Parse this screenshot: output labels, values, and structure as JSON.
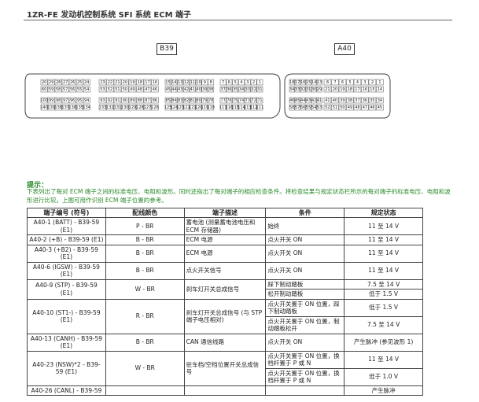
{
  "header": "1ZR-FE 发动机控制系统  SFI 系统  ECM 端子",
  "connectors": {
    "left_label": "B39",
    "right_label": "A40"
  },
  "diagram": {
    "b39_left_top": [
      "20",
      "29",
      "28",
      "27",
      "26",
      "25",
      "24"
    ],
    "b39_left_mid": [
      "60",
      "59",
      "58",
      "57",
      "56",
      "55",
      "54"
    ],
    "b39_left_low1": [
      "100",
      "99",
      "98",
      "97",
      "96",
      "95",
      "94"
    ],
    "b39_left_low2": [
      "140",
      "139",
      "138",
      "137",
      "136",
      "135",
      "134"
    ],
    "b39_mid_top": [
      "23",
      "22",
      "21",
      "20",
      "19",
      "18",
      "17",
      "16"
    ],
    "b39_mid_mid": [
      "53",
      "52",
      "51",
      "50",
      "49",
      "48",
      "47",
      "46"
    ],
    "b39_mid_low1": [
      "93",
      "92",
      "91",
      "90",
      "89",
      "88",
      "87",
      "86"
    ],
    "b39_mid_low2": [
      "133",
      "132",
      "131",
      "130",
      "129",
      "128",
      "127",
      "126"
    ],
    "b39_right_top": [
      "15",
      "14",
      "13",
      "12",
      "11",
      "10",
      "9",
      "8"
    ],
    "b39_right_mid": [
      "45",
      "44",
      "43",
      "42",
      "41",
      "40",
      "39",
      "38"
    ],
    "b39_right_low1": [
      "85",
      "84",
      "83",
      "82",
      "81",
      "80",
      "79",
      "78"
    ],
    "b39_right_low2": [
      "125",
      "124",
      "123",
      "122",
      "121",
      "120",
      "119",
      "118"
    ],
    "b39_end_top": [
      "7",
      "6",
      "5",
      "4",
      "3",
      "2",
      "1"
    ],
    "b39_end_mid": [
      "37",
      "36",
      "35",
      "34",
      "33",
      "32",
      "31"
    ],
    "b39_end_low1": [
      "77",
      "76",
      "75",
      "74",
      "73",
      "72",
      "71"
    ],
    "b39_end_low2": [
      "117",
      "116",
      "115",
      "114",
      "113",
      "112",
      "111"
    ],
    "a40_left_top": [
      "18",
      "17",
      "16",
      "15",
      "14",
      "13"
    ],
    "a40_left_mid": [
      "34",
      "33",
      "32",
      "31",
      "30",
      "29"
    ],
    "a40_left_low1": [
      "46",
      "45",
      "44",
      "43",
      "42",
      "41"
    ],
    "a40_left_low2": [
      "58",
      "57",
      "56",
      "55",
      "54",
      "53"
    ],
    "a40_right_top": [
      "8",
      "7",
      "6",
      "5",
      "4",
      "3",
      "2",
      "1"
    ],
    "a40_right_mid": [
      "21",
      "20",
      "19",
      "18",
      "17",
      "16",
      "15",
      "14"
    ],
    "a40_right_low1": [
      "41",
      "40",
      "39",
      "38",
      "37",
      "36",
      "35",
      "34"
    ],
    "a40_right_low2": [
      "52",
      "51",
      "50",
      "49",
      "48",
      "47",
      "46",
      "45"
    ]
  },
  "hint": {
    "title": "提示：",
    "text": "下表列出了每对 ECM 端子之间的标准电压、电阻和波形。同时还指出了每对端子的相应检查条件。将检查结果与规定状态栏所示的每对端子的标准电压、电阻和波形进行比较。上图可用作识别 ECM 端子位置的参考。"
  },
  "table": {
    "headers": [
      "端子编号 (符号)",
      "配线颜色",
      "端子描述",
      "条件",
      "规定状态"
    ],
    "rows": [
      {
        "term": "A40-1 (BATT) - B39-59 (E1)",
        "color": "P - BR",
        "desc": "蓄电池 (测量蓄电池电压和 ECM 存储器)",
        "cond": [
          "始终"
        ],
        "spec": [
          "11 至 14 V"
        ]
      },
      {
        "term": "A40-2 (+B) - B39-59 (E1)",
        "color": "B - BR",
        "desc": "ECM 电源",
        "cond": [
          "点火开关 ON"
        ],
        "spec": [
          "11 至 14 V"
        ]
      },
      {
        "term": "A40-3 (+B2) - B39-59 (E1)",
        "color": "B - BR",
        "desc": "ECM 电源",
        "cond": [
          "点火开关 ON"
        ],
        "spec": [
          "11 至 14 V"
        ]
      },
      {
        "term": "A40-6 (IGSW) - B39-59 (E1)",
        "color": "B - BR",
        "desc": "点火开关信号",
        "cond": [
          "点火开关 ON"
        ],
        "spec": [
          "11 至 14 V"
        ]
      },
      {
        "term": "A40-9 (STP) - B39-59 (E1)",
        "color": "W - BR",
        "desc": "刹车灯开关总成信号",
        "cond": [
          "踩下制动踏板",
          "松开制动踏板"
        ],
        "spec": [
          "7.5 至 14 V",
          "低于 1.5 V"
        ]
      },
      {
        "term": "A40-10 (ST1-) - B39-59 (E1)",
        "color": "R - BR",
        "desc": "刹车灯开关总成信号 (与 STP 端子电压相对)",
        "cond": [
          "点火开关置于 ON 位置，踩下制动踏板",
          "点火开关置于 ON 位置，制动踏板松开"
        ],
        "spec": [
          "低于 1.5 V",
          "7.5 至 14 V"
        ]
      },
      {
        "term": "A40-13 (CANH) - B39-59 (E1)",
        "color": "B - BR",
        "desc": "CAN 通信线路",
        "cond": [
          "点火开关 ON"
        ],
        "spec": [
          "产生脉冲 (参见波形 1)"
        ]
      },
      {
        "term": "A40-23 (NSW)*2 - B39-59 (E1)",
        "color": "W - BR",
        "desc": "驻车档/空档位置开关总成信号",
        "cond": [
          "点火开关置于 ON 位置，换档杆置于 P 或 N",
          "点火开关置于 ON 位置，换档杆置于 P 或 N"
        ],
        "spec": [
          "11 至 14 V",
          "低于 1.0 V"
        ]
      },
      {
        "term": "A40-26 (CANL) - B39-59",
        "color": "",
        "desc": "",
        "cond": [
          ""
        ],
        "spec": [
          "产生脉冲"
        ]
      }
    ]
  }
}
